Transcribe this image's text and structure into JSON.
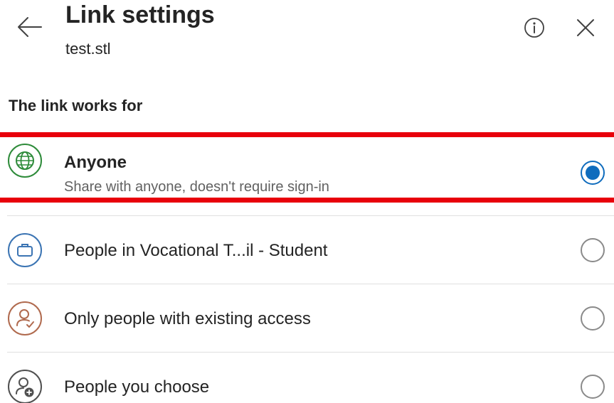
{
  "header": {
    "title": "Link settings",
    "subtitle": "test.stl",
    "back_icon": "arrow-left-icon",
    "info_icon": "info-icon",
    "close_icon": "close-icon"
  },
  "section": {
    "label": "The link works for"
  },
  "options": [
    {
      "label": "Anyone",
      "description": "Share with anyone, doesn't require sign-in",
      "icon": "globe-icon",
      "icon_color": "#2e8b3a",
      "selected": true
    },
    {
      "label": "People in Vocational T...il - Student",
      "icon": "briefcase-icon",
      "icon_color": "#3b74b3",
      "selected": false
    },
    {
      "label": "Only people with existing access",
      "icon": "person-check-icon",
      "icon_color": "#b06a4e",
      "selected": false
    },
    {
      "label": "People you choose",
      "icon": "person-add-icon",
      "icon_color": "#505050",
      "selected": false
    }
  ],
  "colors": {
    "highlight": "#e8000b",
    "radio_selected": "#0f6cbd"
  }
}
